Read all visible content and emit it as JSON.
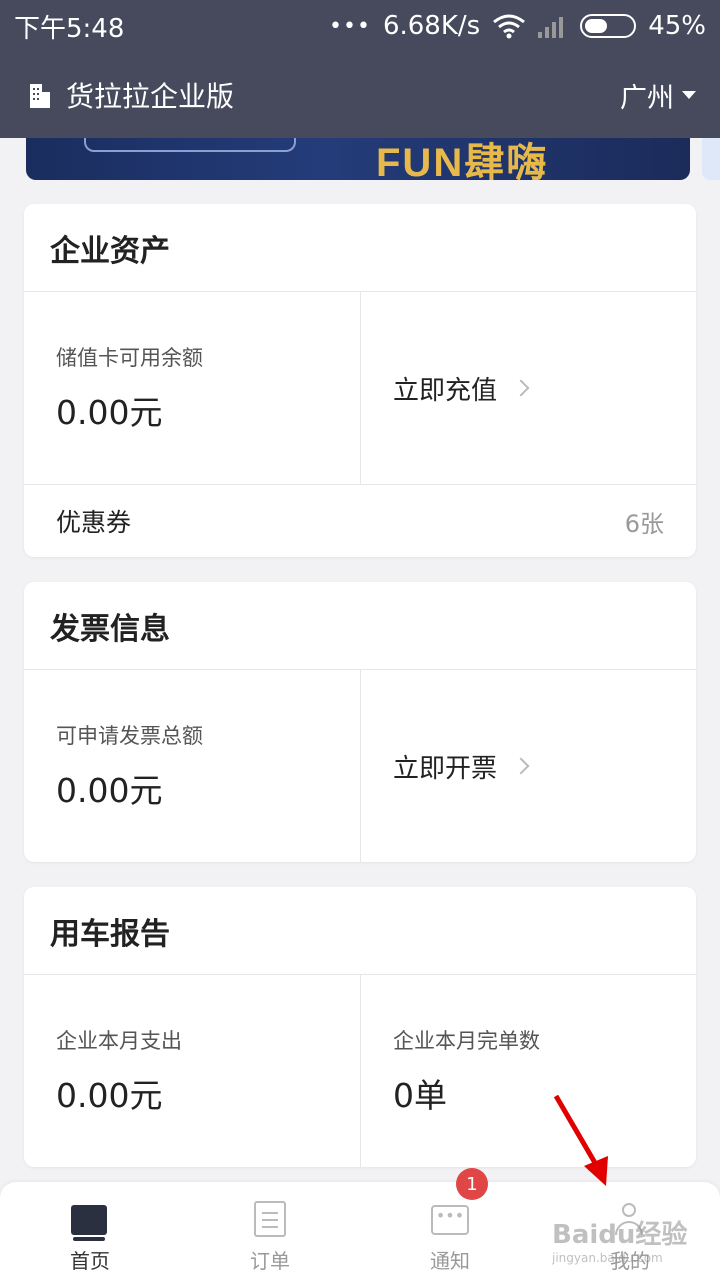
{
  "status_bar": {
    "time": "下午5:48",
    "dots": "•••",
    "network_speed": "6.68K/s",
    "battery": "45%"
  },
  "app_bar": {
    "title": "货拉拉企业版",
    "city": "广州"
  },
  "banner": {
    "art_text": "FUN肆嗨"
  },
  "assets": {
    "title": "企业资产",
    "balance_label": "储值卡可用余额",
    "balance_value": "0.00元",
    "recharge_label": "立即充值",
    "coupon_label": "优惠券",
    "coupon_count": "6张"
  },
  "invoice": {
    "title": "发票信息",
    "amount_label": "可申请发票总额",
    "amount_value": "0.00元",
    "issue_label": "立即开票"
  },
  "report": {
    "title": "用车报告",
    "spend_label": "企业本月支出",
    "spend_value": "0.00元",
    "orders_label": "企业本月完单数",
    "orders_value": "0单"
  },
  "tabs": [
    {
      "label": "首页",
      "active": true
    },
    {
      "label": "订单"
    },
    {
      "label": "通知",
      "badge": "1"
    },
    {
      "label": "我的"
    }
  ],
  "watermark": {
    "text": "Baidu经验",
    "sub": "jingyan.baidu.com"
  },
  "colors": {
    "header_bg": "#464a5c",
    "badge": "#e04646",
    "arrow": "#e00000"
  }
}
